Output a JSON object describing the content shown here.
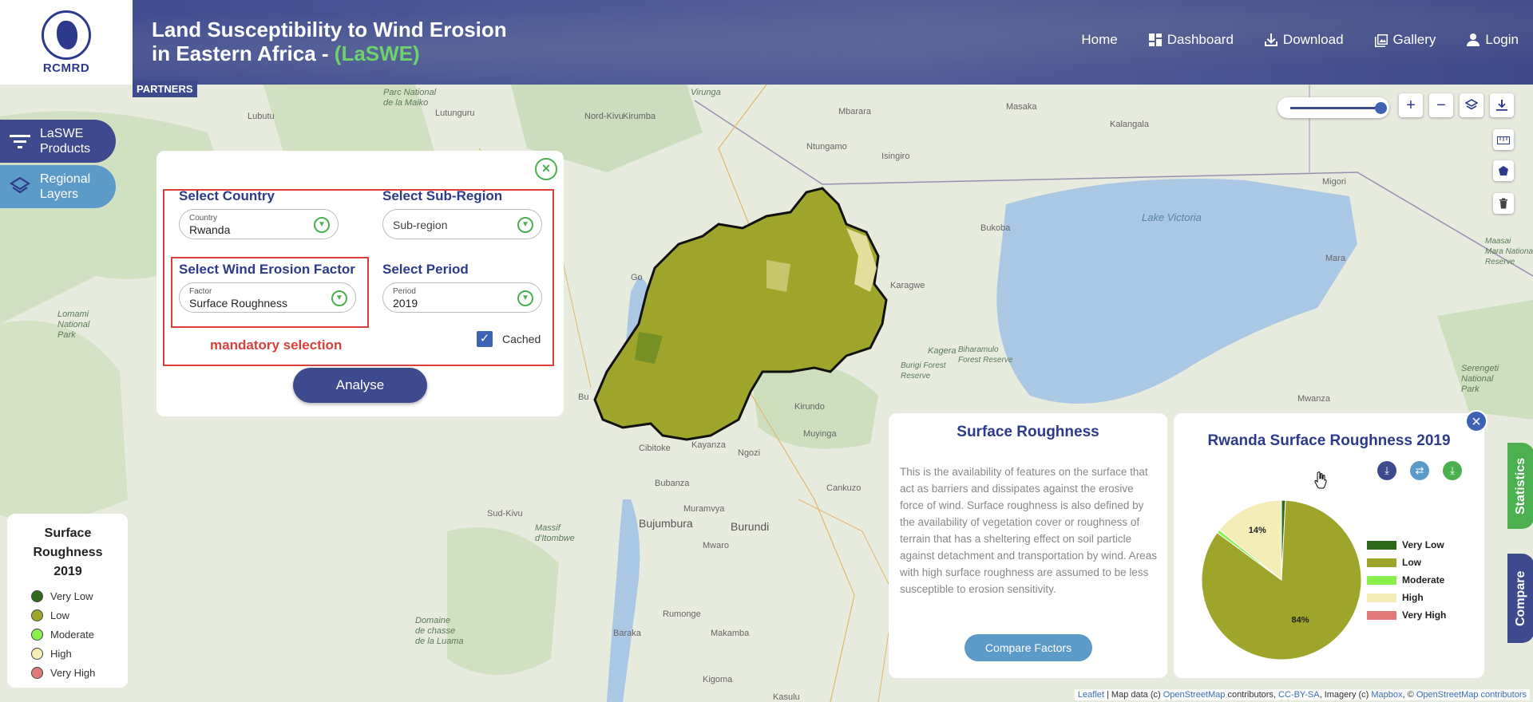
{
  "header": {
    "logo_text": "RCMRD",
    "title_main": "Land Susceptibility to Wind Erosion in Eastern Africa - ",
    "title_accent": "(LaSWE)",
    "partners_label": "PARTNERS",
    "nav": [
      {
        "label": "Home",
        "icon": "none"
      },
      {
        "label": "Dashboard",
        "icon": "dashboard-icon"
      },
      {
        "label": "Download",
        "icon": "download-icon"
      },
      {
        "label": "Gallery",
        "icon": "gallery-icon"
      },
      {
        "label": "Login",
        "icon": "user-icon"
      }
    ]
  },
  "sidebar": {
    "products_label": "LaSWE Products",
    "layers_label": "Regional Layers"
  },
  "selection": {
    "country_heading": "Select Country",
    "country_caption": "Country",
    "country_value": "Rwanda",
    "subregion_heading": "Select Sub-Region",
    "subregion_placeholder": "Sub-region",
    "factor_heading": "Select Wind Erosion Factor",
    "factor_caption": "Factor",
    "factor_value": "Surface Roughness",
    "period_heading": "Select Period",
    "period_caption": "Period",
    "period_value": "2019",
    "mandatory_note": "mandatory selection",
    "cached_label": "Cached",
    "cached_checked": true,
    "analyse_label": "Analyse"
  },
  "map": {
    "labels": [
      {
        "text": "Parc National\nde la Maiko",
        "cls": "it"
      },
      {
        "text": "Lutunguru",
        "cls": ""
      },
      {
        "text": "Lubutu",
        "cls": ""
      },
      {
        "text": "Virunga",
        "cls": "it"
      },
      {
        "text": "Nord-Kivu",
        "cls": ""
      },
      {
        "text": "Kirumba",
        "cls": ""
      },
      {
        "text": "Mbarara",
        "cls": ""
      },
      {
        "text": "Masaka",
        "cls": ""
      },
      {
        "text": "Kalangala",
        "cls": ""
      },
      {
        "text": "Isingiro",
        "cls": ""
      },
      {
        "text": "Ntungamo",
        "cls": ""
      },
      {
        "text": "Lake Victoria",
        "cls": "lake"
      },
      {
        "text": "Bukoba",
        "cls": ""
      },
      {
        "text": "Karagwe",
        "cls": ""
      },
      {
        "text": "Kagera",
        "cls": "it"
      },
      {
        "text": "Burigi Forest\nReserve",
        "cls": "it"
      },
      {
        "text": "Biharamulo\nForest Reserve",
        "cls": "it"
      },
      {
        "text": "Migori",
        "cls": ""
      },
      {
        "text": "Mara",
        "cls": ""
      },
      {
        "text": "Maasai\nMara National\nReserve",
        "cls": "it"
      },
      {
        "text": "Serengeti\nNational\nPark",
        "cls": "it"
      },
      {
        "text": "Kirundo",
        "cls": ""
      },
      {
        "text": "Muyinga",
        "cls": ""
      },
      {
        "text": "Ngozi",
        "cls": ""
      },
      {
        "text": "Kayanza",
        "cls": ""
      },
      {
        "text": "Cibitoke",
        "cls": ""
      },
      {
        "text": "Bubanza",
        "cls": ""
      },
      {
        "text": "Muramvya",
        "cls": ""
      },
      {
        "text": "Bujumbura",
        "cls": "big"
      },
      {
        "text": "Burundi",
        "cls": "big"
      },
      {
        "text": "Mwaro",
        "cls": ""
      },
      {
        "text": "Sud-Kivu",
        "cls": ""
      },
      {
        "text": "Massif\nd'Itombwe",
        "cls": "it"
      },
      {
        "text": "Lomami\nNational\nPark",
        "cls": "it"
      },
      {
        "text": "Rumonge",
        "cls": ""
      },
      {
        "text": "Baraka",
        "cls": ""
      },
      {
        "text": "Makamba",
        "cls": ""
      },
      {
        "text": "Kasulu",
        "cls": ""
      },
      {
        "text": "Kigoma",
        "cls": ""
      },
      {
        "text": "Mwanza",
        "cls": ""
      },
      {
        "text": "Domaine\nde chasse\nde la Luama",
        "cls": "it"
      },
      {
        "text": "Cankuzo",
        "cls": ""
      },
      {
        "text": "Go",
        "cls": ""
      },
      {
        "text": "Bu",
        "cls": ""
      }
    ]
  },
  "legend": {
    "title": "Surface Roughness 2019",
    "items": [
      {
        "label": "Very Low",
        "color": "#2f6a1c"
      },
      {
        "label": "Low",
        "color": "#9ea52a"
      },
      {
        "label": "Moderate",
        "color": "#8cf04c"
      },
      {
        "label": "High",
        "color": "#f5edb8"
      },
      {
        "label": "Very High",
        "color": "#e07a7a"
      }
    ]
  },
  "info": {
    "title": "Surface Roughness",
    "description": "This is the availability of features on the surface that act as barriers and dissipates against the erosive force of wind. Surface roughness is also defined by the availability of vegetation cover or roughness of terrain that has a sheltering effect on soil particle against detachment and transportation by wind. Areas with high surface roughness are assumed to be less susceptible to erosion sensitivity.",
    "compare_label": "Compare Factors"
  },
  "chart_panel": {
    "title": "Rwanda Surface Roughness 2019",
    "tools": [
      "download-icon",
      "swap-icon",
      "download-icon"
    ]
  },
  "chart_data": {
    "type": "pie",
    "title": "Rwanda Surface Roughness 2019",
    "categories": [
      "Very Low",
      "Low",
      "Moderate",
      "High",
      "Very High"
    ],
    "values": [
      0.8,
      84.3,
      0.7,
      14.2,
      0.0
    ],
    "data_labels": {
      "Low": "84%",
      "High": "14%"
    },
    "colors": [
      "#2f6a1c",
      "#9ea52a",
      "#8cf04c",
      "#f5edb8",
      "#e07a7a"
    ],
    "legend_position": "right"
  },
  "tabs": {
    "statistics": "Statistics",
    "compare": "Compare"
  },
  "attribution": {
    "leaflet": "Leaflet",
    "text1": " | Map data (c) ",
    "osm": "OpenStreetMap",
    "text2": " contributors, ",
    "cc": "CC-BY-SA",
    "text3": ", Imagery (c) ",
    "mapbox": "Mapbox",
    "text4": ", © ",
    "osm2": "OpenStreetMap contributors"
  }
}
